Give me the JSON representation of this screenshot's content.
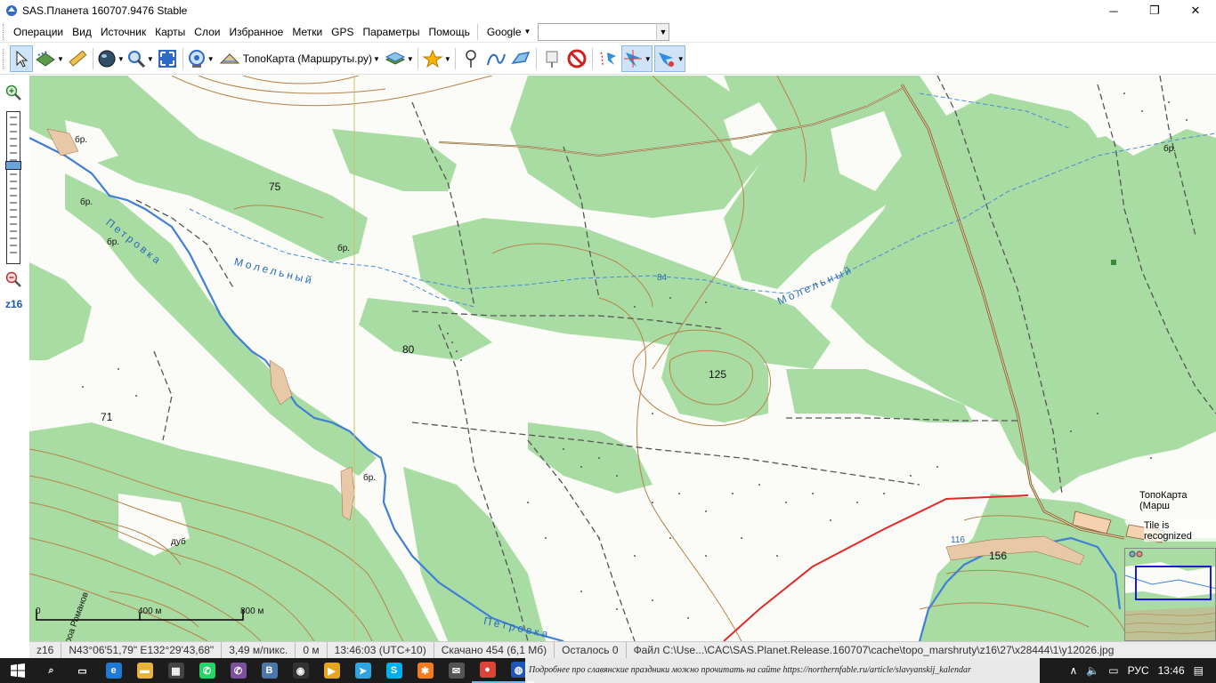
{
  "window": {
    "title": "SAS.Планета 160707.9476 Stable",
    "minimize": "─",
    "maximize": "❐",
    "close": "✕"
  },
  "menu": {
    "items": [
      "Операции",
      "Вид",
      "Источник",
      "Карты",
      "Слои",
      "Избранное",
      "Метки",
      "GPS",
      "Параметры",
      "Помощь"
    ],
    "search_engine": "Google",
    "search_value": ""
  },
  "toolbar": {
    "map_source": "ТопоКарта (Маршруты.ру)",
    "icons": [
      "pointer-icon",
      "select-area-icon",
      "ruler-icon",
      "globe-icon",
      "zoom-icon",
      "fullscreen-icon",
      "gps-icon",
      "map-source-icon",
      "layers-icon",
      "favorites-icon",
      "placemark-icon",
      "path-icon",
      "polygon-icon",
      "marks-icon",
      "no-entry-icon",
      "gps-track-icon",
      "gps-center-icon",
      "gps-connect-icon"
    ]
  },
  "zoom": {
    "level_label": "z16",
    "level": 16
  },
  "map": {
    "labels": {
      "h75": "75",
      "h80": "80",
      "h71": "71",
      "h125": "125",
      "h156": "156",
      "h116": "116",
      "h84": "84",
      "br1": "бр.",
      "br2": "бр.",
      "br3": "бр.",
      "br4": "бр.",
      "br5": "бр.",
      "br6": "бр.",
      "dub": "дуб",
      "river_petrovka": "Петровка",
      "river_petrovka2": "Петровка",
      "river_molelny": "Молельный",
      "river_molelny2": "Молельный",
      "ravine": "роа Романов",
      "scale_0": "0",
      "scale_400": "400 м",
      "scale_800": "800 м"
    },
    "overlay_source": "ТопоКарта (Марш",
    "overlay_status": "Tile is recognized"
  },
  "status": {
    "zoom": "z16",
    "coords": "N43°06'51,79\" E132°29'43,68\"",
    "scale": "3,49 м/пикс.",
    "distance": "0 м",
    "time": "13:46:03 (UTC+10)",
    "downloaded": "Скачано 454 (6,1 Мб)",
    "remaining": "Осталось 0",
    "file": "Файл C:\\Use...\\CAC\\SAS.Planet.Release.160707\\cache\\topo_marshruty\\z16\\27\\x28444\\1\\y12026.jpg"
  },
  "taskbar": {
    "notification": "Подробнее про славянские праздники можно прочитать на сайте https://northernfable.ru/article/slavyanskij_kalendar",
    "lang": "РУС",
    "clock": "13:46",
    "apps": [
      {
        "name": "search",
        "color": "#1c1c1c",
        "glyph": "⌕"
      },
      {
        "name": "task-view",
        "color": "#1c1c1c",
        "glyph": "▭"
      },
      {
        "name": "edge",
        "color": "#1f7ad6",
        "glyph": "e"
      },
      {
        "name": "explorer",
        "color": "#e6b43a",
        "glyph": "▬"
      },
      {
        "name": "store",
        "color": "#444",
        "glyph": "▦"
      },
      {
        "name": "whatsapp",
        "color": "#25d366",
        "glyph": "✆"
      },
      {
        "name": "viber",
        "color": "#7b519d",
        "glyph": "✆"
      },
      {
        "name": "vk",
        "color": "#4a76a8",
        "glyph": "В"
      },
      {
        "name": "app-dark",
        "color": "#333",
        "glyph": "◉"
      },
      {
        "name": "media",
        "color": "#e7a51f",
        "glyph": "▶"
      },
      {
        "name": "telegram",
        "color": "#2ca5e0",
        "glyph": "➤"
      },
      {
        "name": "skype",
        "color": "#00aff0",
        "glyph": "S"
      },
      {
        "name": "app-orange",
        "color": "#f47b20",
        "glyph": "✱"
      },
      {
        "name": "mail",
        "color": "#555",
        "glyph": "✉"
      },
      {
        "name": "chrome",
        "color": "#db4437",
        "glyph": "●"
      },
      {
        "name": "sas-planet",
        "color": "#1b56b8",
        "glyph": "◍"
      }
    ]
  }
}
